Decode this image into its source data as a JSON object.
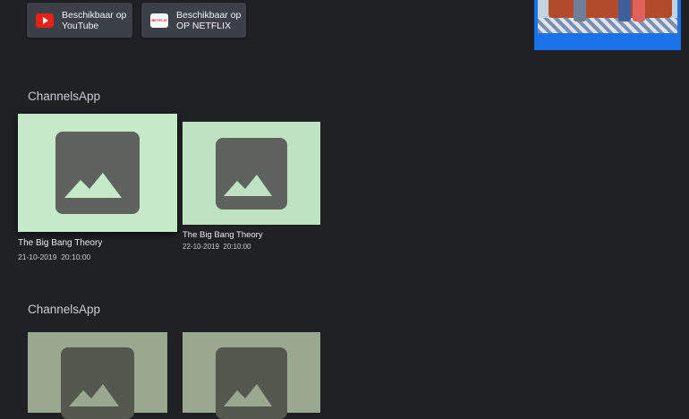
{
  "providers": [
    {
      "label_line1": "Beschikbaar op",
      "label_line2": "YouTube",
      "logo": "youtube-icon"
    },
    {
      "label_line1": "Beschikbaar op",
      "label_line2": "OP NETFLIX",
      "logo": "netflix-icon",
      "logo_text": "NETFLIX"
    }
  ],
  "rows": [
    {
      "title": "ChannelsApp",
      "items": [
        {
          "title": "The Big Bang Theory",
          "datetime": "21-10-2019  20:10:00",
          "focused": true
        },
        {
          "title": "The Big Bang Theory",
          "datetime": "22-10-2019  20:10:00",
          "focused": false
        }
      ]
    },
    {
      "title": "ChannelsApp",
      "items": [
        {
          "title": "",
          "datetime": ""
        },
        {
          "title": "",
          "datetime": ""
        }
      ]
    }
  ],
  "colors": {
    "background": "#202124",
    "card_focused": "#c6e9c9",
    "card": "#bfe2c2",
    "card_dim": "#99a88e",
    "placeholder": "#5f635e",
    "accent": "#1a73e8"
  }
}
